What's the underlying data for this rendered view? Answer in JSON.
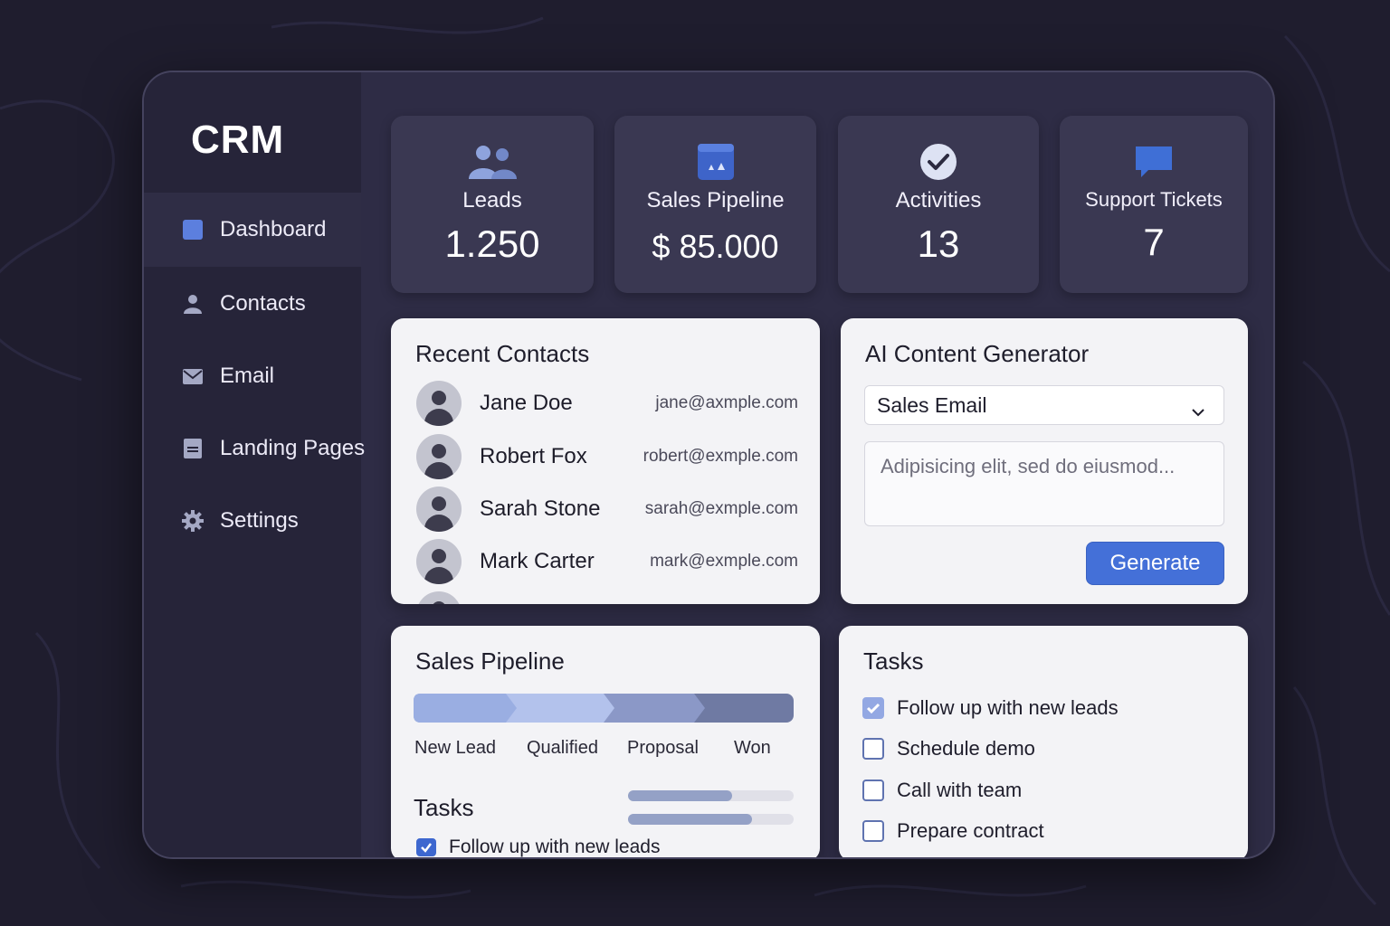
{
  "app": {
    "logo": "CRM"
  },
  "sidebar": {
    "items": [
      {
        "label": "Dashboard",
        "icon": "square-icon",
        "active": true
      },
      {
        "label": "Contacts",
        "icon": "user-icon",
        "active": false
      },
      {
        "label": "Email",
        "icon": "mail-icon",
        "active": false
      },
      {
        "label": "Landing Pages",
        "icon": "page-icon",
        "active": false
      },
      {
        "label": "Settings",
        "icon": "gear-icon",
        "active": false
      }
    ]
  },
  "stats": [
    {
      "label": "Leads",
      "value": "1.250",
      "icon": "users-icon"
    },
    {
      "label": "Sales Pipeline",
      "value": "$ 85.000",
      "icon": "calendar-icon"
    },
    {
      "label": "Activities",
      "value": "13",
      "icon": "check-circle-icon"
    },
    {
      "label": "Support Tickets",
      "value": "7",
      "icon": "chat-icon"
    }
  ],
  "recent_contacts": {
    "title": "Recent Contacts",
    "items": [
      {
        "name": "Jane Doe",
        "email": "jane@axmple.com"
      },
      {
        "name": "Robert Fox",
        "email": "robert@exmple.com"
      },
      {
        "name": "Sarah Stone",
        "email": "sarah@exmple.com"
      },
      {
        "name": "Mark Carter",
        "email": "mark@exmple.com"
      }
    ]
  },
  "ai_generator": {
    "title": "AI Content Generator",
    "selected_type": "Sales Email",
    "prompt_text": "Adipisicing elit, sed do eiusmod...",
    "button_label": "Generate"
  },
  "sales_pipeline": {
    "title": "Sales Pipeline",
    "stages": [
      "New Lead",
      "Qualified",
      "Proposal",
      "Won"
    ],
    "tasks_title": "Tasks",
    "task_progress": [
      0.63,
      0.75
    ],
    "task_preview": "Follow up with new leads"
  },
  "tasks": {
    "title": "Tasks",
    "items": [
      {
        "label": "Follow up with new leads",
        "checked": true
      },
      {
        "label": "Schedule demo",
        "checked": false
      },
      {
        "label": "Call with team",
        "checked": false
      },
      {
        "label": "Prepare contract",
        "checked": false
      }
    ]
  },
  "colors": {
    "background": "#1f1d2e",
    "window": "#2e2c45",
    "sidebar": "#262439",
    "card": "#3a3852",
    "panel": "#f3f3f6",
    "accent": "#4470d8"
  }
}
